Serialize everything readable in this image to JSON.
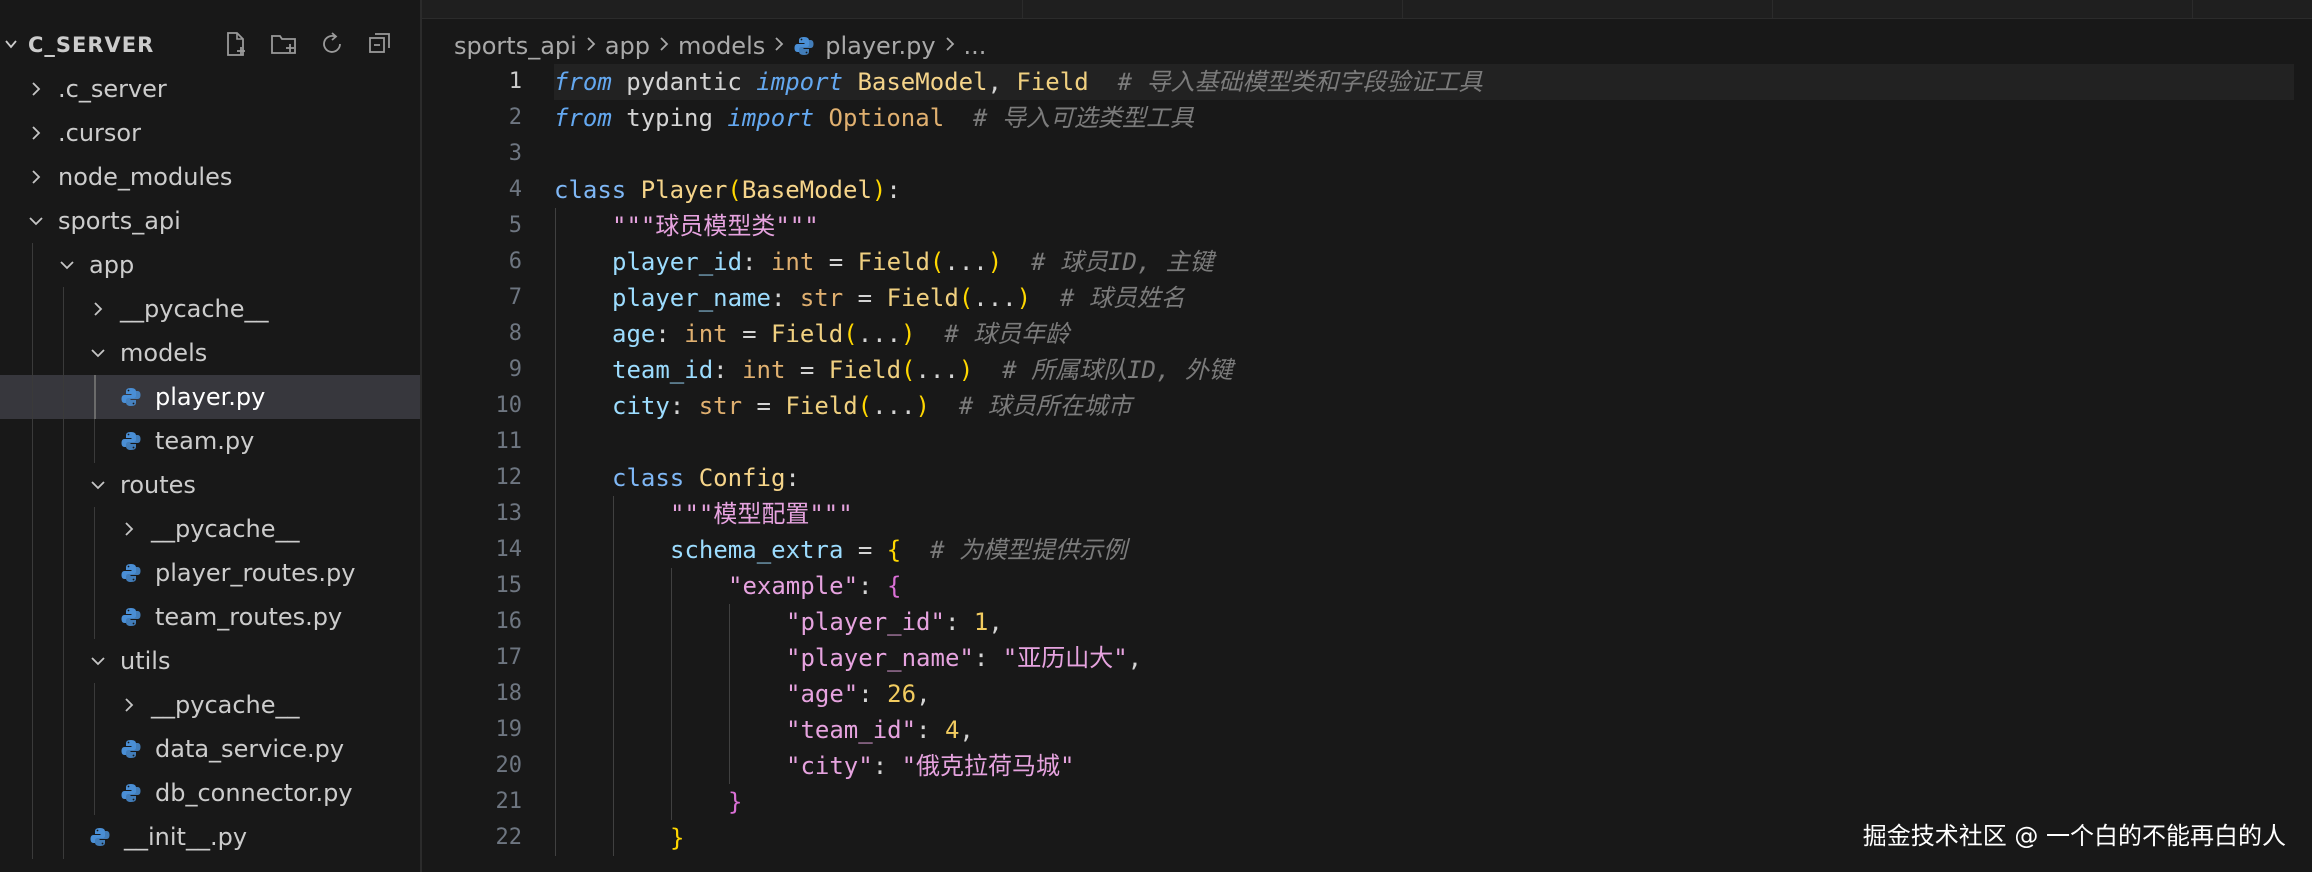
{
  "explorer": {
    "title": "C_SERVER",
    "actions": [
      "new-file-icon",
      "new-folder-icon",
      "refresh-icon",
      "collapse-all-icon"
    ],
    "items": [
      {
        "label": ".c_server",
        "type": "folder",
        "expanded": false,
        "depth": 0
      },
      {
        "label": ".cursor",
        "type": "folder",
        "expanded": false,
        "depth": 0
      },
      {
        "label": "node_modules",
        "type": "folder",
        "expanded": false,
        "depth": 0
      },
      {
        "label": "sports_api",
        "type": "folder",
        "expanded": true,
        "depth": 0
      },
      {
        "label": "app",
        "type": "folder",
        "expanded": true,
        "depth": 1
      },
      {
        "label": "__pycache__",
        "type": "folder",
        "expanded": false,
        "depth": 2
      },
      {
        "label": "models",
        "type": "folder",
        "expanded": true,
        "depth": 2
      },
      {
        "label": "player.py",
        "type": "python",
        "depth": 3,
        "active": true
      },
      {
        "label": "team.py",
        "type": "python",
        "depth": 3
      },
      {
        "label": "routes",
        "type": "folder",
        "expanded": true,
        "depth": 2
      },
      {
        "label": "__pycache__",
        "type": "folder",
        "expanded": false,
        "depth": 3
      },
      {
        "label": "player_routes.py",
        "type": "python",
        "depth": 3
      },
      {
        "label": "team_routes.py",
        "type": "python",
        "depth": 3
      },
      {
        "label": "utils",
        "type": "folder",
        "expanded": true,
        "depth": 2
      },
      {
        "label": "__pycache__",
        "type": "folder",
        "expanded": false,
        "depth": 3
      },
      {
        "label": "data_service.py",
        "type": "python",
        "depth": 3
      },
      {
        "label": "db_connector.py",
        "type": "python",
        "depth": 3
      },
      {
        "label": "__init__.py",
        "type": "python",
        "depth": 2
      }
    ]
  },
  "breadcrumb": {
    "parts": [
      "sports_api",
      "app",
      "models"
    ],
    "file": "player.py",
    "ellipsis": "..."
  },
  "editor": {
    "current_line": 1,
    "lines": [
      {
        "n": "1",
        "indent": 0,
        "tokens": [
          [
            "kw-i",
            "from"
          ],
          [
            "plain",
            " pydantic "
          ],
          [
            "kw-i",
            "import"
          ],
          [
            "plain",
            " "
          ],
          [
            "cls",
            "BaseModel"
          ],
          [
            "pun",
            ", "
          ],
          [
            "fn",
            "Field"
          ],
          [
            "plain",
            "  "
          ],
          [
            "cmt",
            "# 导入基础模型类和字段验证工具"
          ]
        ]
      },
      {
        "n": "2",
        "indent": 0,
        "tokens": [
          [
            "kw-i",
            "from"
          ],
          [
            "plain",
            " typing "
          ],
          [
            "kw-i",
            "import"
          ],
          [
            "plain",
            " "
          ],
          [
            "ty",
            "Optional"
          ],
          [
            "plain",
            "  "
          ],
          [
            "cmt",
            "# 导入可选类型工具"
          ]
        ]
      },
      {
        "n": "3",
        "indent": 0,
        "tokens": []
      },
      {
        "n": "4",
        "indent": 0,
        "tokens": [
          [
            "kw",
            "class"
          ],
          [
            "plain",
            " "
          ],
          [
            "cls",
            "Player"
          ],
          [
            "br1",
            "("
          ],
          [
            "cls",
            "BaseModel"
          ],
          [
            "br1",
            ")"
          ],
          [
            "pun",
            ":"
          ]
        ]
      },
      {
        "n": "5",
        "indent": 1,
        "tokens": [
          [
            "str",
            "\"\"\"球员模型类\"\"\""
          ]
        ]
      },
      {
        "n": "6",
        "indent": 1,
        "tokens": [
          [
            "var",
            "player_id"
          ],
          [
            "pun",
            ": "
          ],
          [
            "ty",
            "int"
          ],
          [
            "pun",
            " = "
          ],
          [
            "fn",
            "Field"
          ],
          [
            "br1",
            "("
          ],
          [
            "pun",
            "..."
          ],
          [
            "br1",
            ")"
          ],
          [
            "plain",
            "  "
          ],
          [
            "cmt",
            "# 球员ID, 主键"
          ]
        ]
      },
      {
        "n": "7",
        "indent": 1,
        "tokens": [
          [
            "var",
            "player_name"
          ],
          [
            "pun",
            ": "
          ],
          [
            "ty",
            "str"
          ],
          [
            "pun",
            " = "
          ],
          [
            "fn",
            "Field"
          ],
          [
            "br1",
            "("
          ],
          [
            "pun",
            "..."
          ],
          [
            "br1",
            ")"
          ],
          [
            "plain",
            "  "
          ],
          [
            "cmt",
            "# 球员姓名"
          ]
        ]
      },
      {
        "n": "8",
        "indent": 1,
        "tokens": [
          [
            "var",
            "age"
          ],
          [
            "pun",
            ": "
          ],
          [
            "ty",
            "int"
          ],
          [
            "pun",
            " = "
          ],
          [
            "fn",
            "Field"
          ],
          [
            "br1",
            "("
          ],
          [
            "pun",
            "..."
          ],
          [
            "br1",
            ")"
          ],
          [
            "plain",
            "  "
          ],
          [
            "cmt",
            "# 球员年龄"
          ]
        ]
      },
      {
        "n": "9",
        "indent": 1,
        "tokens": [
          [
            "var",
            "team_id"
          ],
          [
            "pun",
            ": "
          ],
          [
            "ty",
            "int"
          ],
          [
            "pun",
            " = "
          ],
          [
            "fn",
            "Field"
          ],
          [
            "br1",
            "("
          ],
          [
            "pun",
            "..."
          ],
          [
            "br1",
            ")"
          ],
          [
            "plain",
            "  "
          ],
          [
            "cmt",
            "# 所属球队ID, 外键"
          ]
        ]
      },
      {
        "n": "10",
        "indent": 1,
        "tokens": [
          [
            "var",
            "city"
          ],
          [
            "pun",
            ": "
          ],
          [
            "ty",
            "str"
          ],
          [
            "pun",
            " = "
          ],
          [
            "fn",
            "Field"
          ],
          [
            "br1",
            "("
          ],
          [
            "pun",
            "..."
          ],
          [
            "br1",
            ")"
          ],
          [
            "plain",
            "  "
          ],
          [
            "cmt",
            "# 球员所在城市"
          ]
        ]
      },
      {
        "n": "11",
        "indent": 1,
        "tokens": []
      },
      {
        "n": "12",
        "indent": 1,
        "tokens": [
          [
            "kw",
            "class"
          ],
          [
            "plain",
            " "
          ],
          [
            "cls",
            "Config"
          ],
          [
            "pun",
            ":"
          ]
        ]
      },
      {
        "n": "13",
        "indent": 2,
        "tokens": [
          [
            "str",
            "\"\"\"模型配置\"\"\""
          ]
        ]
      },
      {
        "n": "14",
        "indent": 2,
        "tokens": [
          [
            "var",
            "schema_extra"
          ],
          [
            "pun",
            " = "
          ],
          [
            "br1",
            "{"
          ],
          [
            "plain",
            "  "
          ],
          [
            "cmt",
            "# 为模型提供示例"
          ]
        ]
      },
      {
        "n": "15",
        "indent": 3,
        "tokens": [
          [
            "str",
            "\"example\""
          ],
          [
            "pun",
            ": "
          ],
          [
            "br2",
            "{"
          ]
        ]
      },
      {
        "n": "16",
        "indent": 4,
        "tokens": [
          [
            "str",
            "\"player_id\""
          ],
          [
            "pun",
            ": "
          ],
          [
            "num",
            "1"
          ],
          [
            "pun",
            ","
          ]
        ]
      },
      {
        "n": "17",
        "indent": 4,
        "tokens": [
          [
            "str",
            "\"player_name\""
          ],
          [
            "pun",
            ": "
          ],
          [
            "str",
            "\"亚历山大\""
          ],
          [
            "pun",
            ","
          ]
        ]
      },
      {
        "n": "18",
        "indent": 4,
        "tokens": [
          [
            "str",
            "\"age\""
          ],
          [
            "pun",
            ": "
          ],
          [
            "num",
            "26"
          ],
          [
            "pun",
            ","
          ]
        ]
      },
      {
        "n": "19",
        "indent": 4,
        "tokens": [
          [
            "str",
            "\"team_id\""
          ],
          [
            "pun",
            ": "
          ],
          [
            "num",
            "4"
          ],
          [
            "pun",
            ","
          ]
        ]
      },
      {
        "n": "20",
        "indent": 4,
        "tokens": [
          [
            "str",
            "\"city\""
          ],
          [
            "pun",
            ": "
          ],
          [
            "str",
            "\"俄克拉荷马城\""
          ]
        ]
      },
      {
        "n": "21",
        "indent": 3,
        "tokens": [
          [
            "br2",
            "}"
          ]
        ]
      },
      {
        "n": "22",
        "indent": 2,
        "tokens": [
          [
            "br1",
            "}"
          ]
        ]
      }
    ]
  },
  "watermark": "掘金技术社区 @ 一个白的不能再白的人"
}
